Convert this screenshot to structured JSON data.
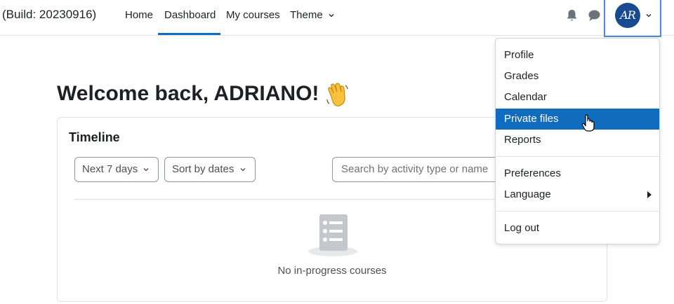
{
  "navbar": {
    "brand": "(Build: 20230916)",
    "links": [
      {
        "label": "Home"
      },
      {
        "label": "Dashboard"
      },
      {
        "label": "My courses"
      },
      {
        "label": "Theme"
      }
    ],
    "avatar_initials": "AR"
  },
  "main": {
    "welcome": "Welcome back, ADRIANO!",
    "timeline": {
      "title": "Timeline",
      "filter_label": "Next 7 days",
      "sort_label": "Sort by dates",
      "search_placeholder": "Search by activity type or name",
      "empty_message": "No in-progress courses"
    }
  },
  "user_dropdown": {
    "items": [
      {
        "label": "Profile"
      },
      {
        "label": "Grades"
      },
      {
        "label": "Calendar"
      },
      {
        "label": "Private files"
      },
      {
        "label": "Reports"
      },
      {
        "label": "Preferences"
      },
      {
        "label": "Language"
      },
      {
        "label": "Log out"
      }
    ],
    "active_item": "Private files"
  },
  "colors": {
    "accent": "#0f6cbf",
    "avatar_bg": "#174a8e",
    "text": "#1d2125",
    "border": "#dee2e6"
  }
}
